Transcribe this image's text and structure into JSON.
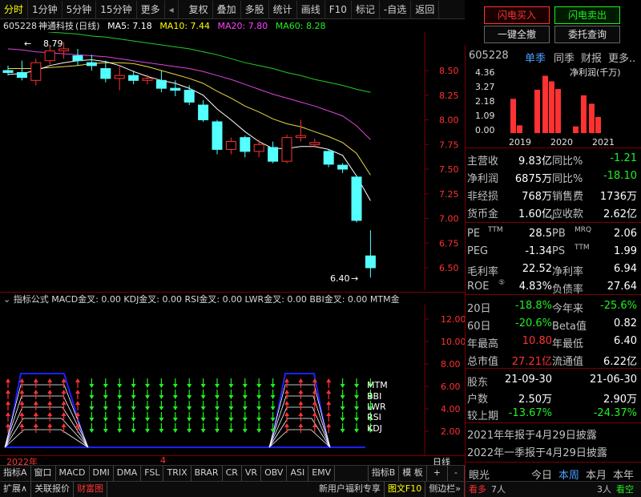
{
  "toolbar": {
    "left": [
      "分时",
      "1分钟",
      "5分钟",
      "15分钟",
      "更多"
    ],
    "right": [
      "复权",
      "叠加",
      "多股",
      "统计",
      "画线",
      "F10",
      "标记",
      "-自选",
      "返回"
    ]
  },
  "trade": {
    "buy": "闪电买入",
    "sell": "闪电卖出",
    "all_cancel": "一键全撤",
    "entrust": "委托查询"
  },
  "chart_title": {
    "code": "605228",
    "name": "神通科技",
    "period": "(日线)",
    "ma5": "MA5: 7.18",
    "ma10": "MA10: 7.44",
    "ma20": "MA20: 7.80",
    "ma60": "MA60: 8.28"
  },
  "price_axis": [
    "8.50",
    "8.25",
    "8.00",
    "7.75",
    "7.50",
    "7.25",
    "7.00",
    "6.75",
    "6.50"
  ],
  "annotations": {
    "high": "8.79",
    "low": "6.40"
  },
  "indicator_bar": "指标公式  MACD金叉: 0.00  KDJ金叉: 0.00  RSI金叉: 0.00  LWR金叉: 0.00  BBI金叉: 0.00  MTM金",
  "ind_axis": [
    "12.00",
    "10.00",
    "8.00",
    "6.00",
    "4.00",
    "2.00"
  ],
  "ind_labels": [
    "MTM",
    "BBI",
    "LWR",
    "RSI",
    "KDJ"
  ],
  "time_axis": {
    "year": "2022年",
    "month": "4",
    "period": "日线"
  },
  "bottom_tabs": [
    "指标A",
    "窗口",
    "MACD",
    "DMI",
    "DMA",
    "FSL",
    "TRIX",
    "BRAR",
    "CR",
    "VR",
    "OBV",
    "ASI",
    "EMV",
    "",
    "指标B",
    "模 板",
    "+",
    "-"
  ],
  "status_bar": {
    "left": [
      "扩展∧",
      "关联报价",
      "财富图"
    ],
    "promo": "新用户福利专享",
    "f10": "图文F10",
    "side": "侧边栏»"
  },
  "panel": {
    "code": "605228",
    "tabs": [
      "单季",
      "同季",
      "财报",
      "更多.."
    ],
    "bar_title": "净利润(千万)",
    "bar_y": [
      "4.36",
      "3.27",
      "2.18",
      "1.09",
      "0.00"
    ],
    "bar_x": [
      "2019",
      "2020",
      "2021"
    ],
    "fin": [
      [
        "主营收",
        "9.83亿",
        "同比%",
        "-1.21"
      ],
      [
        "净利润",
        "6875万",
        "同比%",
        "-18.10"
      ],
      [
        "非经损",
        "768万",
        "销售费",
        "1736万"
      ],
      [
        "货币金",
        "1.60亿",
        "应收款",
        "2.62亿"
      ]
    ],
    "val": [
      [
        "PE",
        "TTM",
        "28.5",
        "PB",
        "MRQ",
        "2.06"
      ],
      [
        "PEG",
        "",
        "-1.34",
        "PS",
        "TTM",
        "1.99"
      ],
      [
        "毛利率",
        "",
        "22.52",
        "净利率",
        "",
        "6.94"
      ],
      [
        "ROE",
        "⑤",
        "4.83%",
        "负债率",
        "",
        "27.64"
      ]
    ],
    "perf": [
      [
        "20日",
        "-18.8%",
        "今年来",
        "-25.6%"
      ],
      [
        "60日",
        "-20.6%",
        "Beta值",
        "0.82"
      ],
      [
        "年最高",
        "10.80",
        "年最低",
        "6.40"
      ],
      [
        "总市值",
        "27.21亿",
        "流通值",
        "6.22亿"
      ]
    ],
    "holders": [
      [
        "股东",
        "21-09-30",
        "21-06-30"
      ],
      [
        "户数",
        "2.50万",
        "2.90万"
      ],
      [
        "较上期",
        "-13.67%",
        "-24.37%"
      ]
    ],
    "notes": [
      "2021年年报于4月29日披露",
      "2022年一季报于4月29日披露"
    ],
    "eyes": {
      "label": "眼光",
      "tabs": [
        "今日",
        "本周",
        "本月",
        "本年"
      ],
      "bull": "看多",
      "bull_n": "7人",
      "bear_n": "3人",
      "bear": "看空"
    }
  },
  "chart_data": {
    "type": "candlestick",
    "ohlc": [
      [
        8.5,
        8.55,
        8.45,
        8.48
      ],
      [
        8.48,
        8.6,
        8.4,
        8.43
      ],
      [
        8.4,
        8.62,
        8.35,
        8.58
      ],
      [
        8.6,
        8.75,
        8.56,
        8.7
      ],
      [
        8.7,
        8.79,
        8.62,
        8.72
      ],
      [
        8.65,
        8.72,
        8.55,
        8.6
      ],
      [
        8.58,
        8.66,
        8.5,
        8.55
      ],
      [
        8.52,
        8.6,
        8.38,
        8.42
      ],
      [
        8.42,
        8.55,
        8.3,
        8.45
      ],
      [
        8.45,
        8.5,
        8.36,
        8.4
      ],
      [
        8.4,
        8.46,
        8.36,
        8.42
      ],
      [
        8.4,
        8.5,
        8.28,
        8.32
      ],
      [
        8.32,
        8.4,
        8.24,
        8.3
      ],
      [
        8.3,
        8.35,
        8.15,
        8.18
      ],
      [
        8.15,
        8.2,
        7.98,
        8.0
      ],
      [
        7.98,
        8.0,
        7.65,
        7.7
      ],
      [
        7.7,
        7.82,
        7.65,
        7.78
      ],
      [
        7.82,
        7.84,
        7.62,
        7.68
      ],
      [
        7.68,
        7.8,
        7.62,
        7.75
      ],
      [
        7.72,
        7.78,
        7.56,
        7.58
      ],
      [
        7.58,
        7.85,
        7.56,
        7.82
      ],
      [
        7.82,
        8.0,
        7.78,
        7.84
      ],
      [
        7.75,
        7.81,
        7.72,
        7.77
      ],
      [
        7.68,
        7.7,
        7.52,
        7.55
      ],
      [
        7.54,
        7.56,
        7.46,
        7.5
      ],
      [
        7.42,
        7.44,
        6.96,
        6.98
      ],
      [
        6.62,
        6.88,
        6.4,
        6.5
      ]
    ],
    "ma5": [
      8.46,
      8.47,
      8.5,
      8.55,
      8.58,
      8.6,
      8.61,
      8.59,
      8.55,
      8.49,
      8.44,
      8.4,
      8.37,
      8.32,
      8.25,
      8.11,
      8.0,
      7.88,
      7.78,
      7.71,
      7.71,
      7.73,
      7.73,
      7.7,
      7.64,
      7.43,
      7.18
    ],
    "ma10": [
      8.52,
      8.52,
      8.52,
      8.53,
      8.54,
      8.55,
      8.57,
      8.58,
      8.58,
      8.57,
      8.54,
      8.5,
      8.46,
      8.42,
      8.37,
      8.29,
      8.22,
      8.14,
      8.08,
      8.01,
      7.96,
      7.93,
      7.88,
      7.83,
      7.77,
      7.66,
      7.44
    ],
    "ma20": [
      8.72,
      8.71,
      8.69,
      8.68,
      8.67,
      8.66,
      8.65,
      8.64,
      8.62,
      8.6,
      8.58,
      8.56,
      8.54,
      8.52,
      8.49,
      8.45,
      8.41,
      8.36,
      8.31,
      8.26,
      8.22,
      8.18,
      8.14,
      8.09,
      8.04,
      7.94,
      7.8
    ],
    "ma60": [
      8.93,
      8.92,
      8.91,
      8.89,
      8.88,
      8.87,
      8.85,
      8.84,
      8.82,
      8.8,
      8.78,
      8.76,
      8.74,
      8.72,
      8.69,
      8.66,
      8.62,
      8.58,
      8.55,
      8.52,
      8.48,
      8.45,
      8.41,
      8.38,
      8.35,
      8.31,
      8.28
    ],
    "net_profit": [
      2.45,
      0.55,
      3.1,
      4.1,
      3.7,
      3.15,
      0.48,
      2.7,
      2.1,
      1.15
    ]
  }
}
